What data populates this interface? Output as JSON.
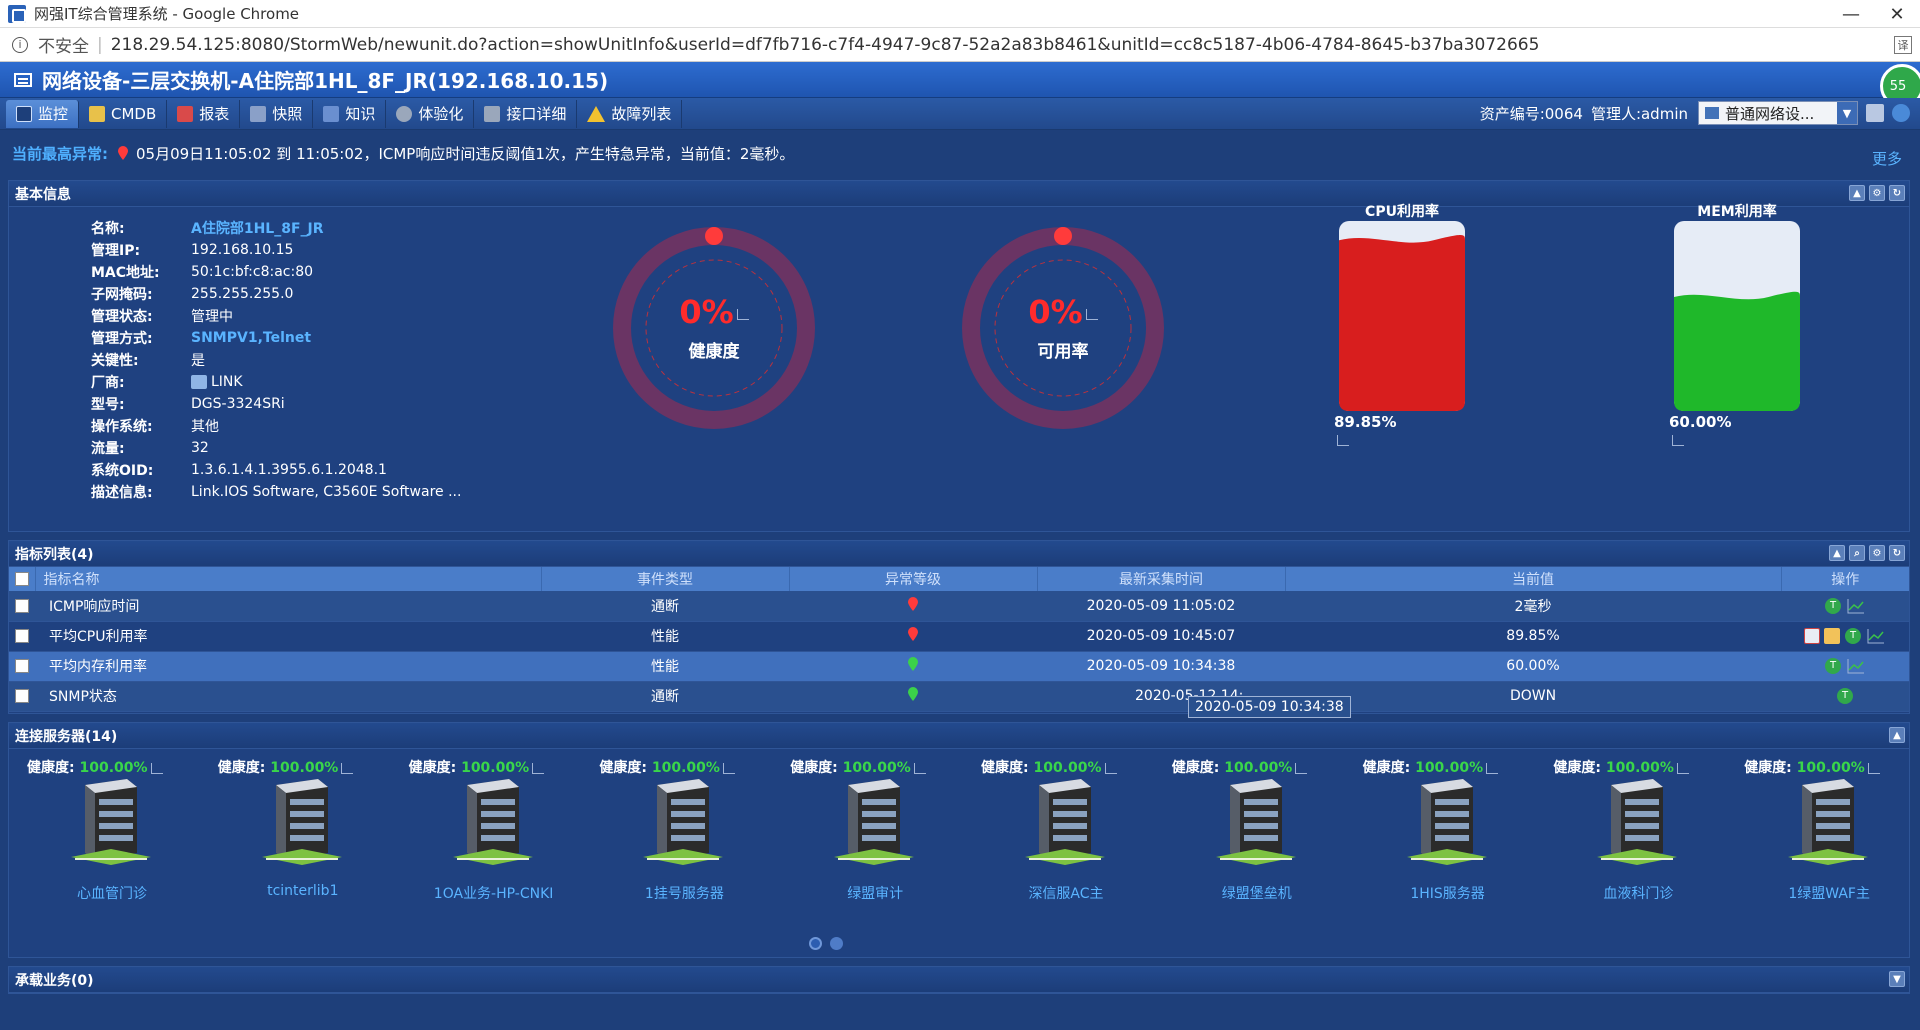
{
  "window": {
    "title": "网强IT综合管理系统 - Google Chrome",
    "minimize": "—",
    "close": "✕"
  },
  "address": {
    "security_label": "不安全",
    "url": "218.29.54.125:8080/StormWeb/newunit.do?action=showUnitInfo&userId=df7fb716-c7f4-4947-9c87-52a2a83b8461&unitId=cc8c5187-4b06-4784-8645-b37ba3072665"
  },
  "header": {
    "title": "网络设备-三层交换机-A住院部1HL_8F_JR(192.168.10.15)",
    "badge": "55"
  },
  "tabs": [
    {
      "label": "监控",
      "color": "#2f5ea8"
    },
    {
      "label": "CMDB",
      "color": "#e8c14a"
    },
    {
      "label": "报表",
      "color": "#d94a4a"
    },
    {
      "label": "快照",
      "color": "#8aa0c8"
    },
    {
      "label": "知识",
      "color": "#6a8fd0"
    },
    {
      "label": "体验化",
      "color": "#9aa7bb"
    },
    {
      "label": "接口详细",
      "color": "#9aa7bb"
    },
    {
      "label": "故障列表",
      "color": "#f2c230"
    }
  ],
  "tab_right": {
    "asset_no": "资产编号:0064",
    "manager": "管理人:admin",
    "select_value": "普通网络设...",
    "select_arrow": "▼"
  },
  "alert": {
    "label": "当前最高异常:",
    "message": "05月09日11:05:02 到 11:05:02，ICMP响应时间违反阈值1次，产生特急异常，当前值：2毫秒。",
    "more": "更多"
  },
  "basic_info": {
    "title": "基本信息",
    "rows": [
      {
        "k": "名称:",
        "v": "A住院部1HL_8F_JR"
      },
      {
        "k": "管理IP:",
        "v": "192.168.10.15"
      },
      {
        "k": "MAC地址:",
        "v": "50:1c:bf:c8:ac:80"
      },
      {
        "k": "子网掩码:",
        "v": "255.255.255.0"
      },
      {
        "k": "管理状态:",
        "v": "管理中"
      },
      {
        "k": "管理方式:",
        "v": "SNMPV1,Telnet"
      },
      {
        "k": "关键性:",
        "v": "是"
      },
      {
        "k": "厂商:",
        "v": "LINK"
      },
      {
        "k": "型号:",
        "v": "DGS-3324SRi"
      },
      {
        "k": "操作系统:",
        "v": "其他"
      },
      {
        "k": "流量:",
        "v": "32"
      },
      {
        "k": "系统OID:",
        "v": "1.3.6.1.4.1.3955.6.1.2048.1"
      },
      {
        "k": "描述信息:",
        "v": "Link.IOS Software, C3560E Software ..."
      }
    ],
    "health": {
      "value": "0%",
      "label": "健康度",
      "fraction": 0
    },
    "availability": {
      "value": "0%",
      "label": "可用率",
      "fraction": 0
    },
    "cpu": {
      "label": "CPU利用率",
      "value": "89.85%",
      "fraction": 0.8985
    },
    "mem": {
      "label": "MEM利用率",
      "value": "60.00%",
      "fraction": 0.6
    }
  },
  "metrics": {
    "title": "指标列表(4)",
    "columns": [
      "指标名称",
      "事件类型",
      "异常等级",
      "最新采集时间",
      "当前值",
      "操作"
    ],
    "rows": [
      {
        "name": "ICMP响应时间",
        "type": "通断",
        "level": "red",
        "time": "2020-05-09 11:05:02",
        "value": "2毫秒"
      },
      {
        "name": "平均CPU利用率",
        "type": "性能",
        "level": "red",
        "time": "2020-05-09 10:45:07",
        "value": "89.85%"
      },
      {
        "name": "平均内存利用率",
        "type": "性能",
        "level": "green",
        "time": "2020-05-09 10:34:38",
        "value": "60.00%"
      },
      {
        "name": "SNMP状态",
        "type": "通断",
        "level": "green",
        "time": "2020-05-12 14:",
        "value": "DOWN"
      }
    ],
    "tooltip": "2020-05-09 10:34:38"
  },
  "servers": {
    "title": "连接服务器(14)",
    "health_label": "健康度:",
    "items": [
      {
        "health": "100.00%",
        "name": "心血管门诊"
      },
      {
        "health": "100.00%",
        "name": "tcinterlib1"
      },
      {
        "health": "100.00%",
        "name": "1OA业务-HP-CNKI"
      },
      {
        "health": "100.00%",
        "name": "1挂号服务器"
      },
      {
        "health": "100.00%",
        "name": "绿盟审计"
      },
      {
        "health": "100.00%",
        "name": "深信服AC主"
      },
      {
        "health": "100.00%",
        "name": "绿盟堡垒机"
      },
      {
        "health": "100.00%",
        "name": "1HIS服务器"
      },
      {
        "health": "100.00%",
        "name": "血液科门诊"
      },
      {
        "health": "100.00%",
        "name": "1绿盟WAF主"
      }
    ]
  },
  "business": {
    "title": "承载业务(0)"
  }
}
